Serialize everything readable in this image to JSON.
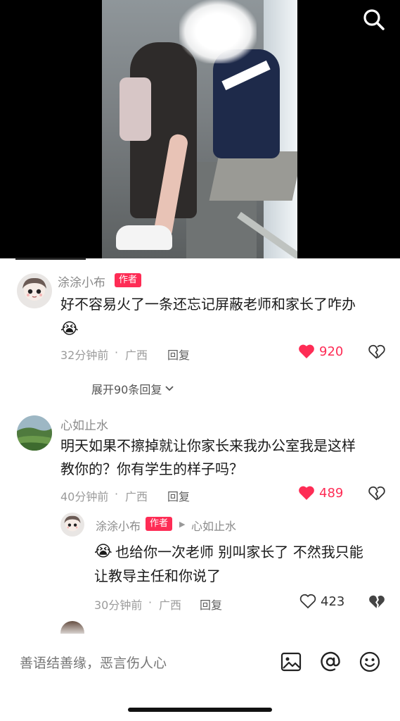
{
  "video": {
    "search_icon": "search-icon"
  },
  "comments": [
    {
      "user": "涂涂小布",
      "badge": "作者",
      "text": "好不容易火了一条还忘记屏蔽老师和家长了咋办",
      "emoji": "😭",
      "time": "32分钟前",
      "location": "广西",
      "reply_label": "回复",
      "likes": "920",
      "liked": true
    },
    {
      "user": "心如止水",
      "text_line1": "明天如果不擦掉就让你家长来我办公室我是这样",
      "text_line2": "教你的？你有学生的样子吗？",
      "time": "40分钟前",
      "location": "广西",
      "reply_label": "回复",
      "likes": "489",
      "liked": true
    }
  ],
  "expand_replies": "展开90条回复",
  "reply": {
    "user": "涂涂小布",
    "badge": "作者",
    "reply_to": "心如止水",
    "emoji": "😭",
    "text_line1": "也给你一次老师 别叫家长了 不然我只能",
    "text_line2": "让教导主任和你说了",
    "time": "30分钟前",
    "location": "广西",
    "reply_label": "回复",
    "likes": "423",
    "liked": false
  },
  "input_bar": {
    "placeholder": "善语结善缘，恶言伤人心",
    "icons": [
      "image-icon",
      "mention-icon",
      "emoji-icon"
    ]
  },
  "colors": {
    "accent": "#fe2c55",
    "like_active": "#fe2c55",
    "meta": "#9b9b9b"
  }
}
